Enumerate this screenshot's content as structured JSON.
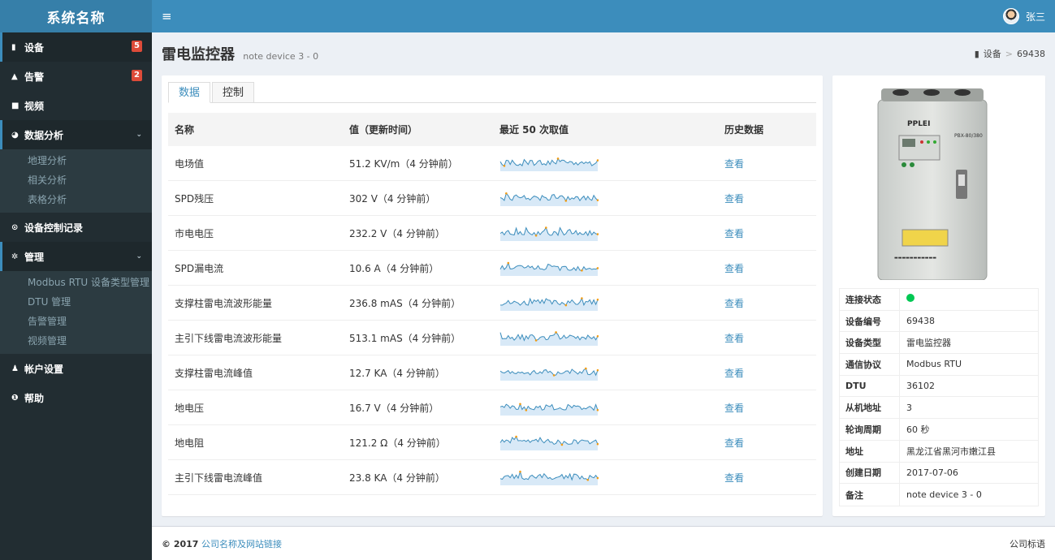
{
  "header": {
    "brand": "系统名称",
    "menu_icon": "≡",
    "user_name": "张三"
  },
  "sidebar": {
    "items": [
      {
        "icon": "▮",
        "label": "设备",
        "badge": "5"
      },
      {
        "icon": "▲",
        "label": "告警",
        "badge": "2"
      },
      {
        "icon": "■",
        "label": "视频"
      },
      {
        "icon": "◕",
        "label": "数据分析",
        "sub": [
          "地理分析",
          "相关分析",
          "表格分析"
        ]
      },
      {
        "icon": "⊙",
        "label": "设备控制记录"
      },
      {
        "icon": "✲",
        "label": "管理",
        "sub": [
          "Modbus RTU 设备类型管理",
          "DTU 管理",
          "告警管理",
          "视频管理"
        ]
      },
      {
        "icon": "♟",
        "label": "帐户设置"
      },
      {
        "icon": "❶",
        "label": "帮助"
      }
    ]
  },
  "page": {
    "title": "雷电监控器",
    "subtitle": "note device 3 - 0"
  },
  "breadcrumb": {
    "icon": "▮",
    "section": "设备",
    "sep": ">",
    "current": "69438"
  },
  "tabs": [
    "数据",
    "控制"
  ],
  "table": {
    "headers": [
      "名称",
      "值（更新时间）",
      "最近 50 次取值",
      "历史数据"
    ],
    "rows": [
      {
        "name": "电场值",
        "value": "51.2 KV/m（4 分钟前）",
        "link": "查看"
      },
      {
        "name": "SPD残压",
        "value": "302 V（4 分钟前）",
        "link": "查看"
      },
      {
        "name": "市电电压",
        "value": "232.2 V（4 分钟前）",
        "link": "查看"
      },
      {
        "name": "SPD漏电流",
        "value": "10.6 A（4 分钟前）",
        "link": "查看"
      },
      {
        "name": "支撑柱雷电流波形能量",
        "value": "236.8 mAS（4 分钟前）",
        "link": "查看"
      },
      {
        "name": "主引下线雷电流波形能量",
        "value": "513.1 mAS（4 分钟前）",
        "link": "查看"
      },
      {
        "name": "支撑柱雷电流峰值",
        "value": "12.7 KA（4 分钟前）",
        "link": "查看"
      },
      {
        "name": "地电压",
        "value": "16.7 V（4 分钟前）",
        "link": "查看"
      },
      {
        "name": "地电阻",
        "value": "121.2 Ω（4 分钟前）",
        "link": "查看"
      },
      {
        "name": "主引下线雷电流峰值",
        "value": "23.8 KA（4 分钟前）",
        "link": "查看"
      }
    ]
  },
  "device": {
    "brand_text": "PPLEI",
    "model_text": "PBX-80/380",
    "info": [
      {
        "key": "连接状态",
        "status": "online",
        "status_color": "#00c853"
      },
      {
        "key": "设备编号",
        "value": "69438"
      },
      {
        "key": "设备类型",
        "value": "雷电监控器"
      },
      {
        "key": "通信协议",
        "value": "Modbus RTU"
      },
      {
        "key": "DTU",
        "value": "36102"
      },
      {
        "key": "从机地址",
        "value": "3"
      },
      {
        "key": "轮询周期",
        "value": "60 秒"
      },
      {
        "key": "地址",
        "value": "黑龙江省黑河市嫩江县"
      },
      {
        "key": "创建日期",
        "value": "2017-07-06"
      },
      {
        "key": "备注",
        "value": "note device 3 - 0"
      }
    ]
  },
  "footer": {
    "copyright": "© 2017",
    "link_text": "公司名称及网站链接",
    "slogan": "公司标语"
  }
}
